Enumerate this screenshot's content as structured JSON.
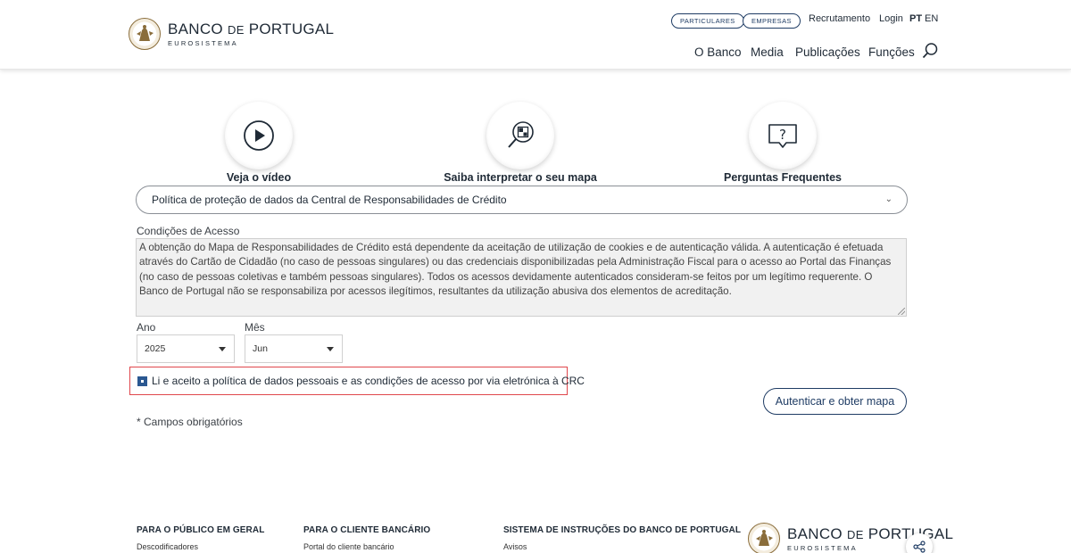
{
  "header": {
    "logo": {
      "name": "BANCO",
      "de": "DE",
      "country": "PORTUGAL",
      "sub": "EUROSISTEMA"
    },
    "pills": {
      "particulares": "PARTICULARES",
      "empresas": "EMPRESAS"
    },
    "links": {
      "recrutamento": "Recrutamento",
      "login": "Login"
    },
    "lang": {
      "pt": "PT",
      "en": "EN"
    },
    "nav": [
      "O Banco",
      "Media",
      "Publicações",
      "Funções"
    ],
    "search_icon": "search-icon"
  },
  "features": [
    {
      "label": "Veja o vídeo",
      "icon": "play-icon"
    },
    {
      "label": "Saiba interpretar o seu mapa",
      "icon": "magnifier-map-icon"
    },
    {
      "label": "Perguntas Frequentes",
      "icon": "question-bubble-icon"
    }
  ],
  "policy_select": {
    "value": "Política de proteção de dados da Central de Responsabilidades de Crédito"
  },
  "conditions": {
    "label": "Condições de Acesso",
    "text": "A obtenção do Mapa de Responsabilidades de Crédito está dependente da aceitação de utilização de cookies e de autenticação válida. A autenticação é efetuada através do Cartão de Cidadão (no caso de pessoas singulares) ou das credenciais disponibilizadas pela Administração Fiscal para o acesso ao Portal das Finanças (no caso de pessoas coletivas e também pessoas singulares). Todos os acessos devidamente autenticados consideram-se feitos por um legítimo requerente. O Banco de Portugal não se responsabiliza por acessos ilegítimos, resultantes da utilização abusiva dos elementos de acreditação."
  },
  "form": {
    "ano_label": "Ano",
    "ano_value": "2025",
    "mes_label": "Mês",
    "mes_value": "Jun",
    "consent_text": "Li e aceito a política de dados pessoais e as condições de acesso por via eletrónica à CRC",
    "consent_checked": true,
    "submit_label": "Autenticar e obter mapa",
    "required_note": "* Campos obrigatórios"
  },
  "footer": {
    "columns": [
      {
        "heading": "PARA O PÚBLICO EM GERAL",
        "link": "Descodificadores"
      },
      {
        "heading": "PARA O CLIENTE BANCÁRIO",
        "link": "Portal do cliente bancário"
      },
      {
        "heading": "SISTEMA DE INSTRUÇÕES DO BANCO DE PORTUGAL",
        "link": "Avisos"
      }
    ],
    "logo": {
      "name": "BANCO",
      "de": "DE",
      "country": "PORTUGAL",
      "sub": "EUROSISTEMA"
    },
    "share_icon": "share-icon"
  },
  "colors": {
    "brand_navy": "#1f3c64",
    "highlight_red": "#e0474c",
    "checkbox_blue": "#2b5891",
    "logo_gold": "#8a6d3b"
  }
}
